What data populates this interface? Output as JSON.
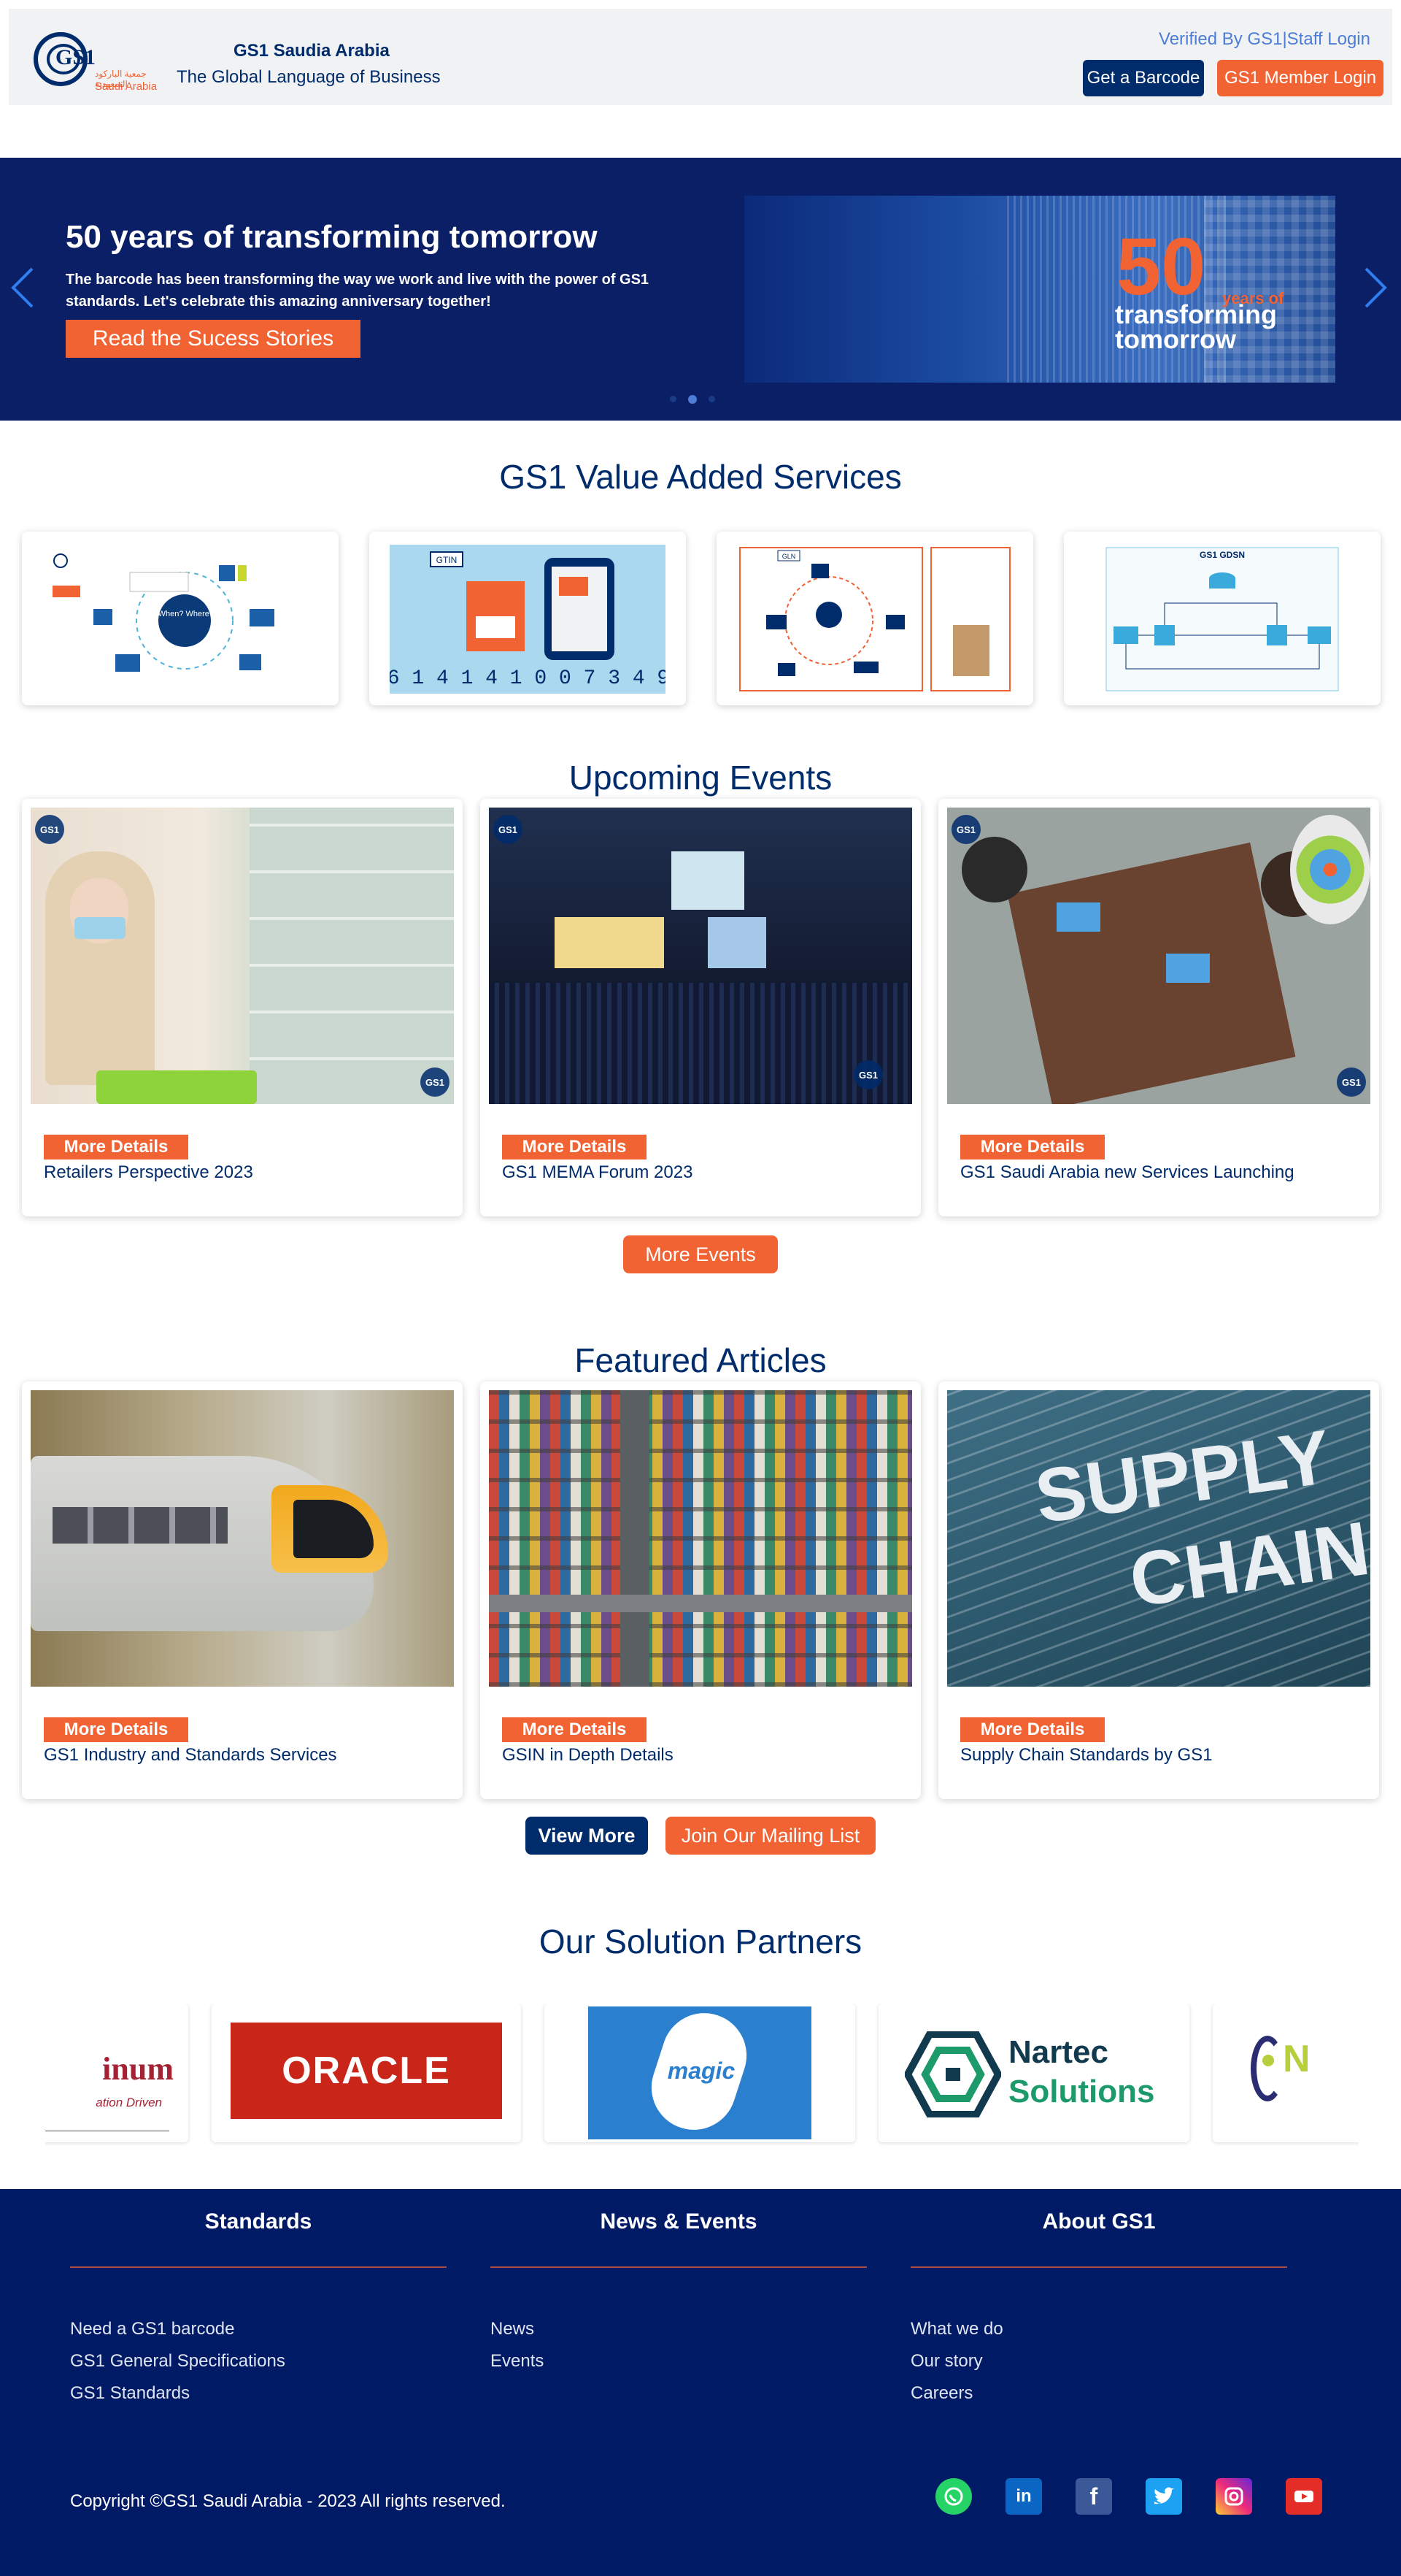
{
  "header": {
    "logo_text": "GS1",
    "logo_sub": "Saudi Arabia",
    "logo_arabic": "جمعية الباركود السعودية",
    "org_name": "GS1 Saudia Arabia",
    "tagline": "The Global Language of Business",
    "verified_link": "Verified By GS1",
    "separator": "|",
    "staff_link": "Staff Login",
    "barcode_button": "Get a Barcode",
    "member_button": "GS1 Member Login"
  },
  "hero": {
    "title": "50 years of transforming tomorrow",
    "text": "The barcode has been transforming the way we work and live with the power of GS1 standards. Let's celebrate this amazing anniversary together!",
    "button": "Read the Sucess Stories",
    "banner_number": "50",
    "banner_years": "years of",
    "banner_line1": "transforming",
    "banner_line2": "tomorrow",
    "slides": 3,
    "active_slide": 2
  },
  "services": {
    "title": "GS1 Value Added Services",
    "items": [
      {
        "label": "What? When? Where? Why?"
      },
      {
        "label": "GTIN",
        "number": "6 1 4 1 4 1 0 0 7 3 4 9"
      },
      {
        "label": "GLN"
      },
      {
        "label": "GS1 GDSN"
      }
    ]
  },
  "events": {
    "title": "Upcoming Events",
    "more_label": "More Details",
    "items": [
      {
        "title": "Retailers Perspective 2023"
      },
      {
        "title": "GS1 MEMA Forum 2023"
      },
      {
        "title": "GS1 Saudi Arabia new Services Launching"
      }
    ],
    "more_button": "More Events"
  },
  "articles": {
    "title": "Featured Articles",
    "more_label": "More Details",
    "items": [
      {
        "title": "GS1 Industry and Standards Services"
      },
      {
        "title": "GSIN in Depth Details"
      },
      {
        "title": "Supply Chain Standards by GS1"
      }
    ],
    "view_more": "View More",
    "mailing": "Join Our Mailing List",
    "supply_text": "SUPPLY",
    "chain_text": "CHAIN"
  },
  "partners": {
    "title": "Our Solution Partners",
    "items": [
      {
        "name": "inum",
        "sub": "ation Driven"
      },
      {
        "name": "ORACLE"
      },
      {
        "name": "magic"
      },
      {
        "name": "Nartec",
        "sub": "Solutions"
      },
      {
        "name": "N"
      }
    ]
  },
  "footer": {
    "columns": [
      {
        "title": "Standards",
        "links": [
          "Need a GS1 barcode",
          "GS1 General Specifications",
          "GS1 Standards"
        ]
      },
      {
        "title": "News & Events",
        "links": [
          "News",
          "Events"
        ]
      },
      {
        "title": "About GS1",
        "links": [
          "What we do",
          "Our story",
          "Careers"
        ]
      }
    ],
    "copyright": "Copyright ©GS1 Saudi Arabia - 2023 All rights reserved.",
    "social": [
      {
        "icon": "whatsapp-icon",
        "color": "#25d366"
      },
      {
        "icon": "linkedin-icon",
        "color": "#0a66c2"
      },
      {
        "icon": "facebook-icon",
        "color": "#3b5998"
      },
      {
        "icon": "twitter-icon",
        "color": "#1da1f2"
      },
      {
        "icon": "instagram-icon",
        "color": "#d62976"
      },
      {
        "icon": "youtube-icon",
        "color": "#e52d27"
      }
    ]
  },
  "colors": {
    "navy": "#002c6c",
    "orange": "#f26334",
    "footer": "#001a66",
    "hero": "#0b1f66"
  }
}
